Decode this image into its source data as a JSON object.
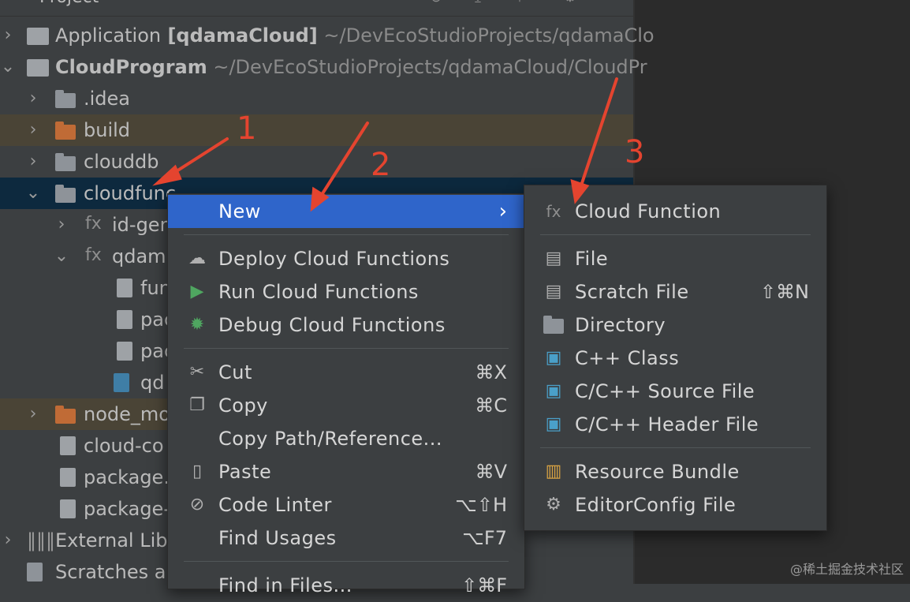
{
  "header": {
    "title": "Project"
  },
  "tree": [
    {
      "name": "Application",
      "suffix": " [qdamaCloud]",
      "path": " ~/DevEcoStudioProjects/qdamaClo"
    },
    {
      "name": "CloudProgram",
      "path": " ~/DevEcoStudioProjects/qdamaCloud/CloudPr"
    },
    {
      "name": ".idea"
    },
    {
      "name": "build"
    },
    {
      "name": "clouddb"
    },
    {
      "name": "cloudfunc"
    },
    {
      "name": "id-gen"
    },
    {
      "name": "qdam"
    },
    {
      "name": "fun"
    },
    {
      "name": "pac"
    },
    {
      "name": "pac"
    },
    {
      "name": "qd"
    },
    {
      "name": "node_mo"
    },
    {
      "name": "cloud-co"
    },
    {
      "name": "package."
    },
    {
      "name": "package-"
    },
    {
      "name": "External Libr"
    },
    {
      "name": "Scratches a"
    }
  ],
  "context_menu": {
    "new": "New",
    "new_arrow": "›",
    "deploy": "Deploy Cloud Functions",
    "run": "Run Cloud Functions",
    "debug": "Debug Cloud Functions",
    "cut": "Cut",
    "cut_key": "⌘X",
    "copy": "Copy",
    "copy_key": "⌘C",
    "copy_path": "Copy Path/Reference...",
    "paste": "Paste",
    "paste_key": "⌘V",
    "code_linter": "Code Linter",
    "code_linter_key": "⌥⇧H",
    "find_usages": "Find Usages",
    "find_usages_key": "⌥F7",
    "find_in_files": "Find in Files...",
    "find_in_files_key": "⇧⌘F"
  },
  "new_submenu": {
    "cloud_function": "Cloud Function",
    "file": "File",
    "scratch_file": "Scratch File",
    "scratch_key": "⇧⌘N",
    "directory": "Directory",
    "cpp_class": "C++ Class",
    "cpp_source": "C/C++ Source File",
    "cpp_header": "C/C++ Header File",
    "resource_bundle": "Resource Bundle",
    "editorconfig": "EditorConfig File"
  },
  "annotations": {
    "n1": "1",
    "n2": "2",
    "n3": "3"
  },
  "watermark": "@稀土掘金技术社区",
  "colors": {
    "highlight": "#2f65ca",
    "annotation": "#e4442f",
    "selection": "#0d293e"
  }
}
